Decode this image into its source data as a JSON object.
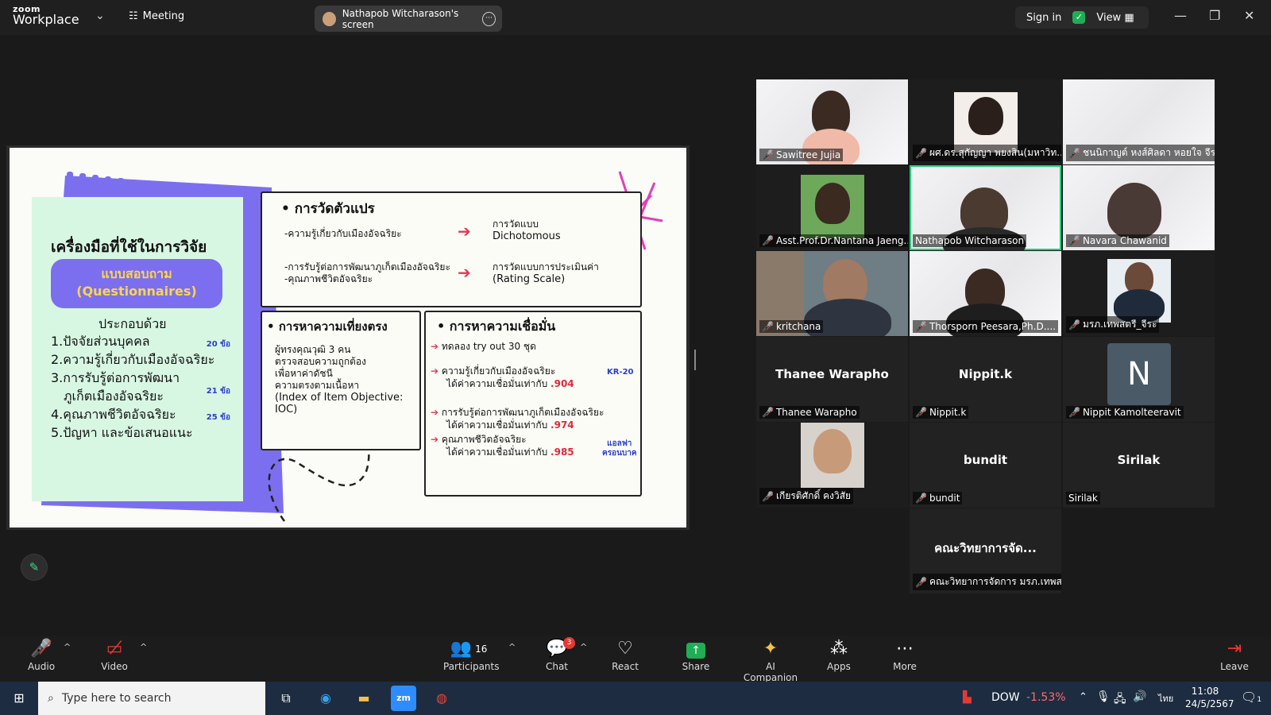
{
  "titlebar": {
    "logo_top": "zoom",
    "logo_bottom": "Workplace",
    "meeting_label": "Meeting",
    "screen_label": "Nathapob Witcharason's screen",
    "sign_in": "Sign in",
    "view": "View"
  },
  "slide": {
    "tool_title": "เครื่องมือที่ใช้ในการวิจัย",
    "questionnaire_th": "แบบสอบถาม",
    "questionnaire_en": "(Questionnaires)",
    "consists_of": "ประกอบด้วย",
    "items": [
      {
        "text": "1.ปัจจัยส่วนบุคคล",
        "badge": "20 ข้อ"
      },
      {
        "text": "2.ความรู้เกี่ยวกับเมืองอัจฉริยะ",
        "badge": ""
      },
      {
        "text": "3.การรับรู้ต่อการพัฒนา",
        "badge": ""
      },
      {
        "text": "ภูเก็ตเมืองอัจฉริยะ",
        "badge": "21 ข้อ"
      },
      {
        "text": "4.คุณภาพชีวิตอัจฉริยะ",
        "badge": "25 ข้อ"
      },
      {
        "text": "5.ปัญหา และข้อเสนอแนะ",
        "badge": ""
      }
    ],
    "var_box": {
      "title": "การวัดตัวแปร",
      "row1_left": "-ความรู้เกี่ยวกับเมืองอัจฉริยะ",
      "row1_right_1": "การวัดแบบ",
      "row1_right_2": "Dichotomous",
      "row2_left_1": "-การรับรู้ต่อการพัฒนาภูเก็ตเมืองอัจฉริยะ",
      "row2_left_2": "-คุณภาพชีวิตอัจฉริยะ",
      "row2_right_1": "การวัดแบบการประเมินค่า",
      "row2_right_2": "(Rating Scale)"
    },
    "validity": {
      "title": "การหาความเที่ยงตรง",
      "lines": [
        "ผู้ทรงคุณวุฒิ 3 คน",
        "ตรวจสอบความถูกต้อง",
        "เพื่อหาค่าดัชนี",
        "ความตรงตามเนื้อหา",
        "(Index of Item Objective:",
        "IOC)"
      ]
    },
    "reliability": {
      "title": "การหาความเชื่อมั่น",
      "tryout": "ทดลอง try out 30 ชุด",
      "r1_a": "ความรู้เกี่ยวกับเมืองอัจฉริยะ",
      "r1_b": "ได้ค่าความเชื่อมั่นเท่ากับ",
      "r1_v": ".904",
      "kr": "KR-20",
      "r2_a": "การรับรู้ต่อการพัฒนาภูเก็ตเมืองอัจฉริยะ",
      "r2_b": "ได้ค่าความเชื่อมั่นเท่ากับ",
      "r2_v": ".974",
      "r3_a": "คุณภาพชีวิตอัจฉริยะ",
      "r3_b": "ได้ค่าความเชื่อมั่นเท่ากับ",
      "r3_v": ".985",
      "alpha_1": "แอลฟา",
      "alpha_2": "ครอนบาค"
    }
  },
  "participants": [
    {
      "name": "Sawitree Jujia",
      "muted": true,
      "video": true
    },
    {
      "name": "ผศ.ดร.สุกัญญา พยงสิน(มหาวิท...",
      "muted": true,
      "video": true
    },
    {
      "name": "ชนนิกาญต์ หงส์ศิลดา หอยใจ จีร...",
      "muted": true,
      "video": true
    },
    {
      "name": "Asst.Prof.Dr.Nantana Jaeng...",
      "muted": true,
      "video": true
    },
    {
      "name": "Nathapob Witcharason",
      "muted": false,
      "video": true,
      "speaking": true
    },
    {
      "name": "Navara Chawanid",
      "muted": true,
      "video": true
    },
    {
      "name": "kritchana",
      "muted": true,
      "video": true
    },
    {
      "name": "Thorsporn Peesara,Ph.D....",
      "muted": true,
      "video": true
    },
    {
      "name": "มรภ.เทพสตรี_จีระ",
      "muted": true,
      "video": true
    },
    {
      "name": "Thanee Warapho",
      "display": "Thanee Warapho",
      "muted": true,
      "video": false
    },
    {
      "name": "Nippit.k",
      "display": "Nippit.k",
      "muted": true,
      "video": false
    },
    {
      "name": "Nippit Kamolteeravit",
      "display": "N",
      "muted": true,
      "video": false
    },
    {
      "name": "เกียรติศักดิ์ คงวิสัย",
      "muted": true,
      "video": true
    },
    {
      "name": "bundit",
      "display": "bundit",
      "muted": true,
      "video": false
    },
    {
      "name": "Sirilak",
      "display": "Sirilak",
      "muted": false,
      "video": false
    },
    {
      "name": "คณะวิทยาการจัดการ มรภ.เทพส...",
      "display": "คณะวิทยาการจัด...",
      "muted": true,
      "video": false
    }
  ],
  "toolbar": {
    "audio": "Audio",
    "video": "Video",
    "participants": "Participants",
    "participants_count": "16",
    "chat": "Chat",
    "chat_badge": "3",
    "react": "React",
    "share": "Share",
    "ai": "AI Companion",
    "apps": "Apps",
    "more": "More",
    "leave": "Leave"
  },
  "taskbar": {
    "search_placeholder": "Type here to search",
    "stock_name": "DOW",
    "stock_change": "-1.53%",
    "lang": "ไทย",
    "time": "11:08",
    "date": "24/5/2567",
    "notif_count": "1"
  },
  "colors": {
    "accent_green": "#1fd07a",
    "share_green": "#1fae55",
    "mute_red": "#e53935",
    "slide_purple": "#7b6ff0",
    "slide_mint": "#d8f7e3"
  }
}
